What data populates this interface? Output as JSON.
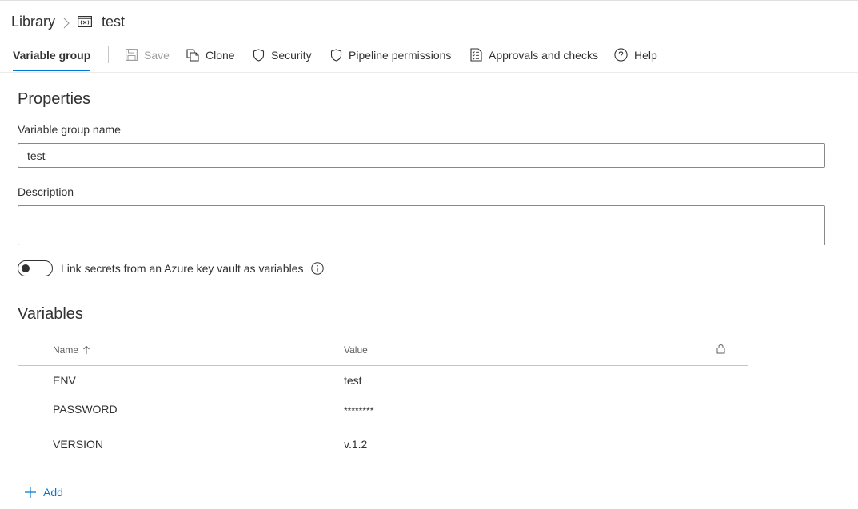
{
  "breadcrumb": {
    "root": "Library",
    "current": "test"
  },
  "toolbar": {
    "active_tab": "Variable group",
    "save": "Save",
    "clone": "Clone",
    "security": "Security",
    "pipeline_permissions": "Pipeline permissions",
    "approvals": "Approvals and checks",
    "help": "Help"
  },
  "properties": {
    "title": "Properties",
    "name_label": "Variable group name",
    "name_value": "test",
    "description_label": "Description",
    "description_value": "",
    "keyvault_label": "Link secrets from an Azure key vault as variables",
    "keyvault_enabled": false
  },
  "variables": {
    "title": "Variables",
    "columns": {
      "name": "Name",
      "value": "Value"
    },
    "rows": [
      {
        "name": "ENV",
        "value": "test"
      },
      {
        "name": "PASSWORD",
        "value": "********"
      },
      {
        "name": "VERSION",
        "value": "v.1.2"
      }
    ],
    "add_label": "Add"
  },
  "icons": {
    "breadcrumb_separator": "chevron-right-icon",
    "variable_group": "variable-group-icon",
    "save": "save-icon",
    "clone": "clone-icon",
    "security": "shield-icon",
    "pipeline_permissions": "shield-icon",
    "approvals": "checklist-icon",
    "help": "help-icon",
    "info": "info-icon",
    "sort": "sort-ascending-icon",
    "lock": "lock-icon",
    "add": "plus-icon"
  },
  "colors": {
    "accent": "#0078d4",
    "text": "#323130",
    "disabled": "#a19f9d"
  }
}
